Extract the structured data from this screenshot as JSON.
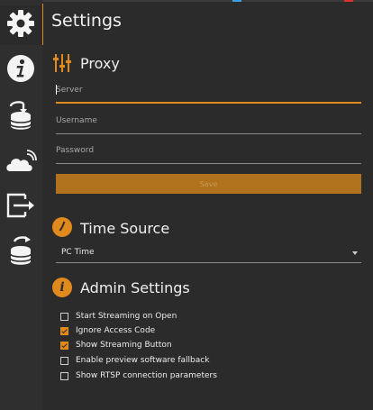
{
  "colors": {
    "accent": "#e08a1e",
    "background": "#2b2b2b",
    "sidebar": "#2f2f2f"
  },
  "sidebar": {
    "items": [
      {
        "icon": "gear-icon"
      },
      {
        "icon": "info-icon"
      },
      {
        "icon": "database-import-icon"
      },
      {
        "icon": "cloud-stream-icon"
      },
      {
        "icon": "export-icon"
      },
      {
        "icon": "database-refresh-icon"
      }
    ]
  },
  "page": {
    "title": "Settings"
  },
  "proxy": {
    "title": "Proxy",
    "server_label": "Server",
    "username_label": "Username",
    "password_label": "Password",
    "save_label": "Save"
  },
  "time_source": {
    "title": "Time Source",
    "selected": "PC Time"
  },
  "admin": {
    "title": "Admin Settings",
    "options": [
      {
        "label": "Start Streaming on Open",
        "checked": false
      },
      {
        "label": "Ignore Access Code",
        "checked": true
      },
      {
        "label": "Show Streaming Button",
        "checked": true
      },
      {
        "label": "Enable preview software fallback",
        "checked": false
      },
      {
        "label": "Show RTSP connection parameters",
        "checked": false
      }
    ]
  }
}
